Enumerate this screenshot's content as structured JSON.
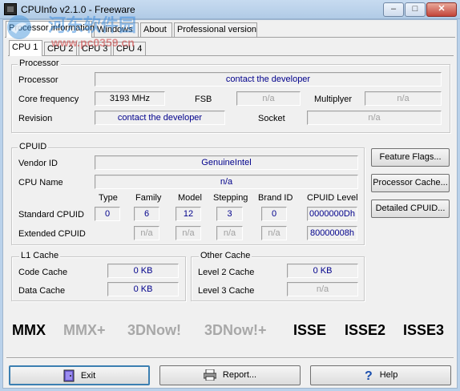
{
  "window": {
    "title": "CPUInfo v2.1.0 - Freeware",
    "min": "–",
    "max": "□",
    "close": "✕"
  },
  "watermark": {
    "line1": "河东软件园",
    "line2": "www.pc0359.cn"
  },
  "tabs": [
    "Processor information",
    "Windows",
    "About",
    "Professional version"
  ],
  "cpu_tabs": [
    "CPU 1",
    "CPU 2",
    "CPU 3",
    "CPU 4"
  ],
  "processor": {
    "group": "Processor",
    "processor_label": "Processor",
    "processor_value": "contact the developer",
    "core_freq_label": "Core frequency",
    "core_freq_value": "3193 MHz",
    "fsb_label": "FSB",
    "fsb_value": "n/a",
    "multiplier_label": "Multiplyer",
    "multiplier_value": "n/a",
    "revision_label": "Revision",
    "revision_value": "contact the developer",
    "socket_label": "Socket",
    "socket_value": "n/a"
  },
  "cpuid": {
    "group": "CPUID",
    "vendor_label": "Vendor ID",
    "vendor_value": "GenuineIntel",
    "name_label": "CPU Name",
    "name_value": "n/a",
    "col_type": "Type",
    "col_family": "Family",
    "col_model": "Model",
    "col_stepping": "Stepping",
    "col_brand": "Brand ID",
    "col_level": "CPUID Level",
    "standard_label": "Standard CPUID",
    "standard": {
      "type": "0",
      "family": "6",
      "model": "12",
      "stepping": "3",
      "brand": "0",
      "level": "0000000Dh"
    },
    "extended_label": "Extended CPUID",
    "extended": {
      "type": "",
      "family": "n/a",
      "model": "n/a",
      "stepping": "n/a",
      "brand": "n/a",
      "level": "80000008h"
    }
  },
  "side_buttons": {
    "feature_flags": "Feature Flags...",
    "processor_cache": "Processor Cache...",
    "detailed_cpuid": "Detailed CPUID..."
  },
  "l1": {
    "group": "L1 Cache",
    "code_label": "Code Cache",
    "code_value": "0 KB",
    "data_label": "Data Cache",
    "data_value": "0 KB"
  },
  "other": {
    "group": "Other Cache",
    "l2_label": "Level 2 Cache",
    "l2_value": "0 KB",
    "l3_label": "Level 3 Cache",
    "l3_value": "n/a"
  },
  "features": {
    "mmx": "MMX",
    "mmx_plus": "MMX+",
    "now": "3DNow!",
    "now_plus": "3DNow!+",
    "isse": "ISSE",
    "isse2": "ISSE2",
    "isse3": "ISSE3"
  },
  "bottom": {
    "exit": "Exit",
    "report": "Report...",
    "help": "Help"
  }
}
